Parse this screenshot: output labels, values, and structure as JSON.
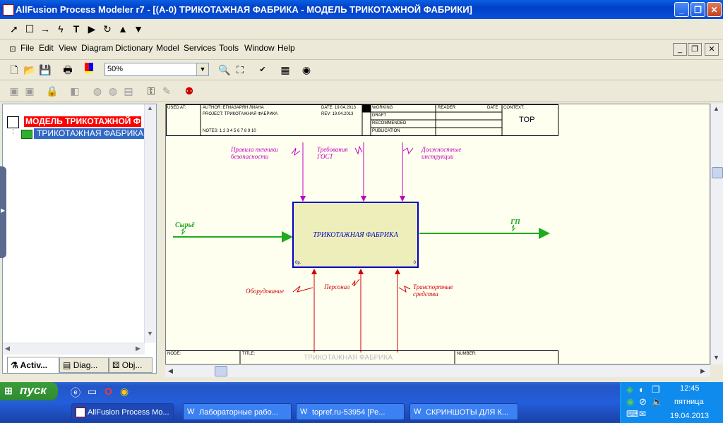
{
  "window": {
    "title": "AllFusion Process Modeler r7 - [(A-0) ТРИКОТАЖНАЯ ФАБРИКА - МОДЕЛЬ ТРИКОТАЖНОЙ ФАБРИКИ]",
    "minimize": "_",
    "maximize": "❐",
    "close": "✕"
  },
  "menu": {
    "items": [
      "File",
      "Edit",
      "View",
      "Diagram",
      "Dictionary",
      "Model",
      "Services",
      "Tools",
      "Window",
      "Help"
    ]
  },
  "toolbar": {
    "zoom_value": "50%"
  },
  "tree": {
    "root": "МОДЕЛЬ ТРИКОТАЖНОЙ Ф",
    "child": "ТРИКОТАЖНАЯ ФАБРИКА",
    "panel_close": "×"
  },
  "left_tabs": [
    "Activ...",
    "Diag...",
    "Obj..."
  ],
  "diagram": {
    "header": {
      "used_at": "USED AT:",
      "author": "AUTHOR:  ЕГИАЗАРЯН ЛИАНА",
      "project": "PROJECT:  ТРИКОТАЖНАЯ ФАБРИКА",
      "date": "DATE: 19.04.2013",
      "rev": "REV:  19.04.2013",
      "notes": "NOTES:  1  2  3  4  5  6  7  8  9  10",
      "working": "WORKING",
      "draft": "DRAFT",
      "recommended": "RECOMMENDED",
      "publication": "PUBLICATION",
      "reader": "READER",
      "date2": "DATE",
      "context": "CONTEXT:",
      "context_value": "TOP"
    },
    "activity": {
      "name": "ТРИКОТАЖНАЯ ФАБРИКА",
      "cost": "0р.",
      "number": "0"
    },
    "arrows": {
      "input": "Сырьё",
      "output": "ГП",
      "controls": [
        "Правила техники безопасности",
        "Требования ГОСТ",
        "Должностные инструкции"
      ],
      "mechanisms": [
        "Оборудование",
        "Персонал",
        "Транспортные средства"
      ]
    },
    "footer": {
      "node": "NODE:",
      "title": "TITLE:",
      "title_value": "ТРИКОТАЖНАЯ ФАБРИКА",
      "number": "NUMBER:"
    }
  },
  "taskbar": {
    "start": "пуск",
    "tasks": [
      "AllFusion Process Mo...",
      "Лабораторные рабо...",
      "topref.ru-53954 [Ре...",
      "СКРИНШОТЫ ДЛЯ К..."
    ],
    "clock": "12:45",
    "day": "пятница",
    "date": "19.04.2013"
  },
  "colors": {
    "control": "#c000c0",
    "mechanism": "#d00000",
    "input_output": "#1faa1f",
    "activity_fill": "#eeeebb",
    "activity_border": "#0000c0",
    "tree_root_bg": "#ff0000",
    "tree_selected_bg": "#316ac5"
  }
}
